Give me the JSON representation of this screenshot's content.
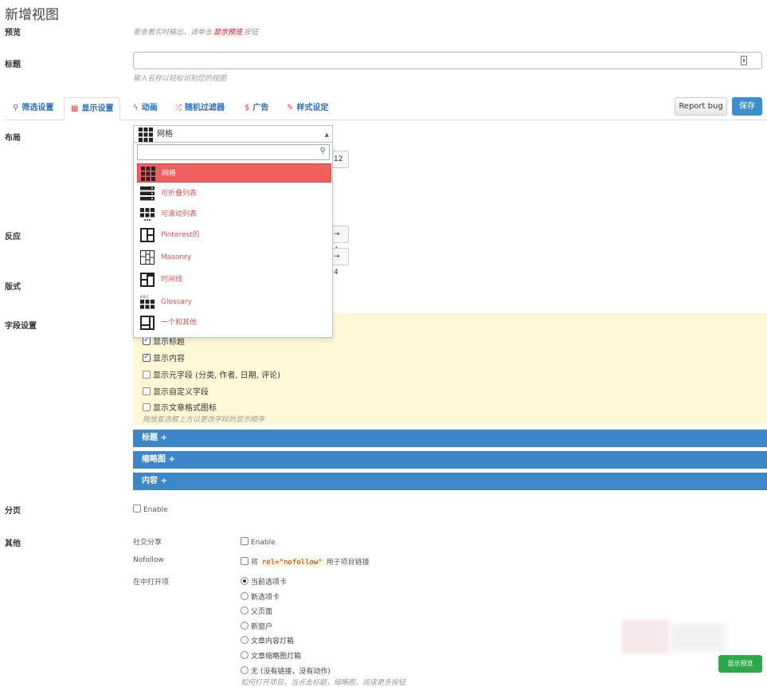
{
  "page": {
    "title": "新增视图"
  },
  "preview": {
    "label": "预览",
    "hint_prefix": "要查看实时输出，请单击",
    "hint_highlight": "显示预览",
    "hint_suffix": "按钮"
  },
  "title_field": {
    "label": "标题",
    "value": "",
    "hint": "输入名称以轻松识别您的视图"
  },
  "tabs": [
    {
      "label": "筛选设置",
      "icon": "search-icon"
    },
    {
      "label": "显示设置",
      "icon": "grid-icon"
    },
    {
      "label": "动画",
      "icon": "bolt-icon"
    },
    {
      "label": "随机过滤器",
      "icon": "shuffle-icon"
    },
    {
      "label": "广告",
      "icon": "dollar-icon"
    },
    {
      "label": "样式设定",
      "icon": "pencil-icon"
    }
  ],
  "buttons": {
    "report_bug": "Report bug",
    "save": "保存"
  },
  "rows": {
    "layout": "布局",
    "responsive": "反应",
    "format": "版式",
    "fields": "字段设置",
    "pagination": "分页",
    "other": "其他"
  },
  "layout_select": {
    "selected": "网格",
    "search_value": "",
    "options": [
      "网格",
      "可折叠列表",
      "可滚动列表",
      "Pinterest的",
      "Masonry",
      "时间线",
      "Glossary",
      "一个和其他"
    ]
  },
  "behind_values": {
    "columns": "12",
    "resp1": "→ 4",
    "resp2": "→ 4"
  },
  "fields": {
    "items": [
      {
        "label": "显示标题",
        "checked": true
      },
      {
        "label": "显示内容",
        "checked": true
      },
      {
        "label": "显示元字段 (分类, 作者, 日期, 评论)",
        "checked": false
      },
      {
        "label": "显示自定义字段",
        "checked": false
      },
      {
        "label": "显示文章格式图标",
        "checked": false
      }
    ],
    "hint": "拖放复选框上方以更改字段的显示顺序"
  },
  "accordions": [
    "标题 +",
    "缩略图 +",
    "内容 +"
  ],
  "pagination": {
    "enable": "Enable"
  },
  "other": {
    "social_label": "社交分享",
    "social_enable": "Enable",
    "nofollow_label": "Nofollow",
    "nofollow_pre": "将",
    "nofollow_code": "rel=\"nofollow\"",
    "nofollow_post": "用于项目链接",
    "open_label": "在中打开项",
    "open_options": [
      "当前选项卡",
      "新选项卡",
      "父页面",
      "新窗户",
      "文章内容灯箱",
      "文章缩略图灯箱",
      "无 (没有链接，没有动作)"
    ],
    "open_selected": "当前选项卡",
    "open_hint": "如何打开项目，当点击标题，缩略图，阅读更多按钮"
  },
  "floating": {
    "preview": "显示预览"
  },
  "colors": {
    "accent": "#3c87c9",
    "selected_option": "#f25d5d",
    "success": "#2ea84a",
    "tab_text": "#2a6ebb"
  }
}
